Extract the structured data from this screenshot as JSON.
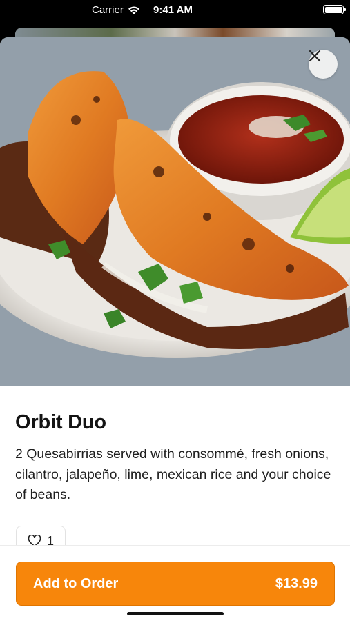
{
  "status_bar": {
    "carrier": "Carrier",
    "time": "9:41 AM"
  },
  "item": {
    "name": "Orbit Duo",
    "description": "2 Quesabirrias served with consommé, fresh onions, cilantro, jalapeño, lime, mexican rice and your choice of beans.",
    "like_count": "1"
  },
  "order_button": {
    "label": "Add to Order",
    "price": "$13.99"
  },
  "colors": {
    "accent": "#f7860b",
    "text_primary": "#141414"
  },
  "icons": {
    "close": "close-icon",
    "like": "heart-icon",
    "wifi": "wifi-icon",
    "battery": "battery-icon"
  }
}
